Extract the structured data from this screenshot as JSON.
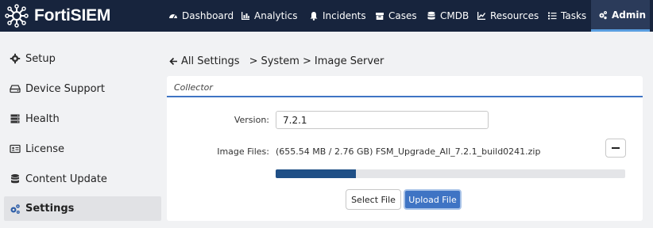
{
  "app": {
    "brand": "FortiSIEM"
  },
  "nav": {
    "items": [
      {
        "label": "Dashboard",
        "icon": "dashboard-icon"
      },
      {
        "label": "Analytics",
        "icon": "bar-chart-icon"
      },
      {
        "label": "Incidents",
        "icon": "bell-icon"
      },
      {
        "label": "Cases",
        "icon": "cases-icon"
      },
      {
        "label": "CMDB",
        "icon": "database-icon"
      },
      {
        "label": "Resources",
        "icon": "resources-icon"
      },
      {
        "label": "Tasks",
        "icon": "tasks-icon"
      },
      {
        "label": "Admin",
        "icon": "cogs-icon",
        "active": true
      }
    ]
  },
  "sidebar": {
    "items": [
      {
        "label": "Setup",
        "icon": "gear-icon"
      },
      {
        "label": "Device Support",
        "icon": "hdd-icon"
      },
      {
        "label": "Health",
        "icon": "server-icon"
      },
      {
        "label": "License",
        "icon": "id-card-icon"
      },
      {
        "label": "Content Update",
        "icon": "database-icon"
      },
      {
        "label": "Settings",
        "icon": "cogs-icon",
        "active": true
      }
    ]
  },
  "breadcrumb": {
    "back_label": "All Settings",
    "sep": ">",
    "section": "System",
    "page": "Image Server"
  },
  "panel": {
    "title": "Collector",
    "version_label": "Version:",
    "version_value": "7.2.1",
    "image_files_label": "Image Files:",
    "file_info": "(655.54 MB / 2.76 GB) FSM_Upgrade_All_7.2.1_build0241.zip",
    "progress_fraction": 0.23,
    "select_file_label": "Select File",
    "upload_file_label": "Upload File"
  },
  "colors": {
    "topbar": "#17243d",
    "accent": "#3f74c4",
    "progress": "#1f4f86"
  }
}
